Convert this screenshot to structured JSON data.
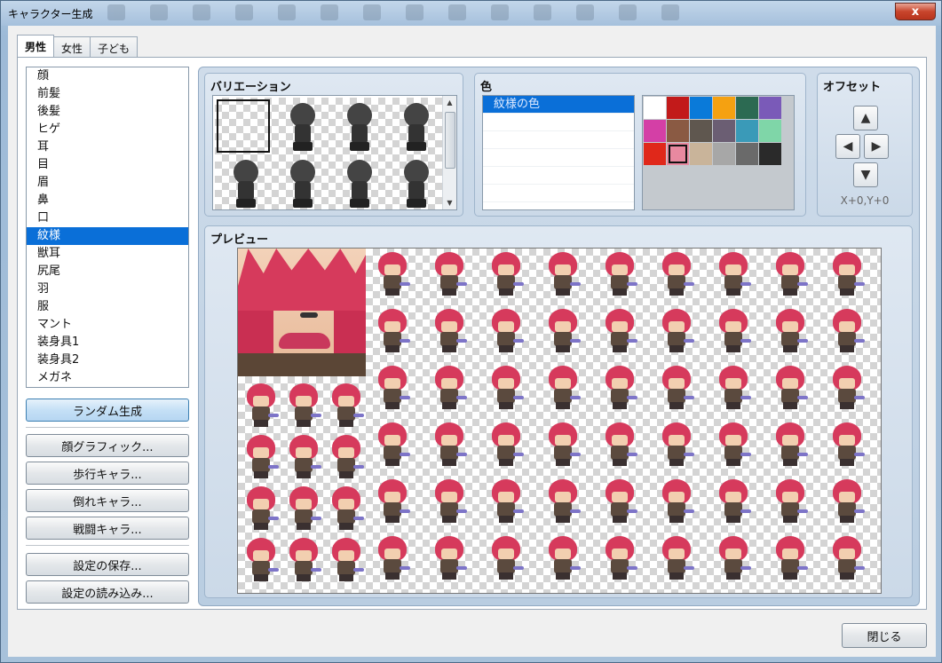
{
  "window": {
    "title": "キャラクター生成",
    "close_glyph": "x"
  },
  "tabs": [
    "男性",
    "女性",
    "子ども"
  ],
  "parts": {
    "items": [
      "顔",
      "前髪",
      "後髪",
      "ヒゲ",
      "耳",
      "目",
      "眉",
      "鼻",
      "口",
      "紋様",
      "獣耳",
      "尻尾",
      "羽",
      "服",
      "マント",
      "装身具1",
      "装身具2",
      "メガネ"
    ],
    "selected": "紋様"
  },
  "buttons": {
    "random": "ランダム生成",
    "face_graphic": "顔グラフィック...",
    "walk_chara": "歩行キャラ...",
    "down_chara": "倒れキャラ...",
    "battle_chara": "戦闘キャラ...",
    "save_settings": "設定の保存...",
    "load_settings": "設定の読み込み...",
    "close": "閉じる"
  },
  "variation": {
    "title": "バリエーション"
  },
  "color": {
    "title": "色",
    "rows": [
      "紋様の色"
    ]
  },
  "palette_colors": [
    [
      "#ffffff",
      "#c21a1a",
      "#0a7ad9",
      "#f5a111",
      "#2c6a52",
      "#7a5ab8"
    ],
    [
      "#d43fa6",
      "#8a5a43",
      "#5f574f",
      "#6b5e73",
      "#3a9ab8",
      "#7fd6a8"
    ],
    [
      "#e0281a",
      "#e889a0",
      "#c9b49a",
      "#a7a7a7",
      "#6a6a6a",
      "#2a2a2a"
    ]
  ],
  "offset": {
    "title": "オフセット",
    "up": "▲",
    "left": "◀",
    "right": "▶",
    "down": "▼",
    "value": "X+0,Y+0"
  },
  "preview": {
    "title": "プレビュー"
  },
  "colors": {
    "selection": "#0a6fd8",
    "hair": "#d63a5c",
    "panel": "#cbd9e8"
  }
}
